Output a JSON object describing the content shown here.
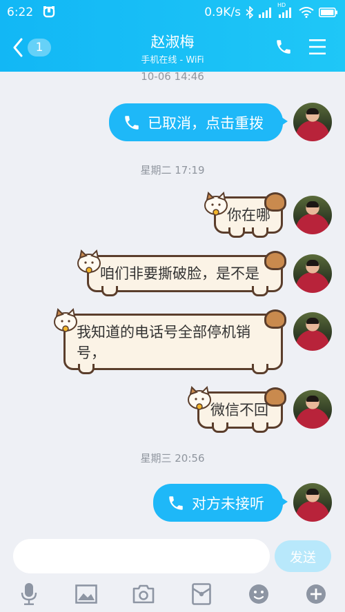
{
  "status_bar": {
    "time": "6:22",
    "network_speed": "0.9K/s",
    "hd_label": "HD"
  },
  "header": {
    "back_count": "1",
    "contact_name": "赵淑梅",
    "contact_status": "手机在线 - WiFi",
    "accent_color": "#12b7f5"
  },
  "messages": [
    {
      "timestamp": "10-06 14:46"
    },
    {
      "type": "call",
      "text": "已取消，点击重拨"
    },
    {
      "timestamp": "星期二 17:19"
    },
    {
      "type": "text",
      "text": "你在哪"
    },
    {
      "type": "text",
      "text": "咱们非要撕破脸，是不是"
    },
    {
      "type": "text",
      "text": "我知道的电话号全部停机销号，"
    },
    {
      "type": "text",
      "text": "微信不回"
    },
    {
      "timestamp": "星期三 20:56"
    },
    {
      "type": "call",
      "text": "对方未接听"
    }
  ],
  "input": {
    "placeholder": "",
    "value": "",
    "send_label": "发送"
  },
  "toolbar": {
    "icons": [
      "microphone-icon",
      "image-icon",
      "camera-icon",
      "red-packet-icon",
      "emoji-icon",
      "plus-icon"
    ]
  }
}
